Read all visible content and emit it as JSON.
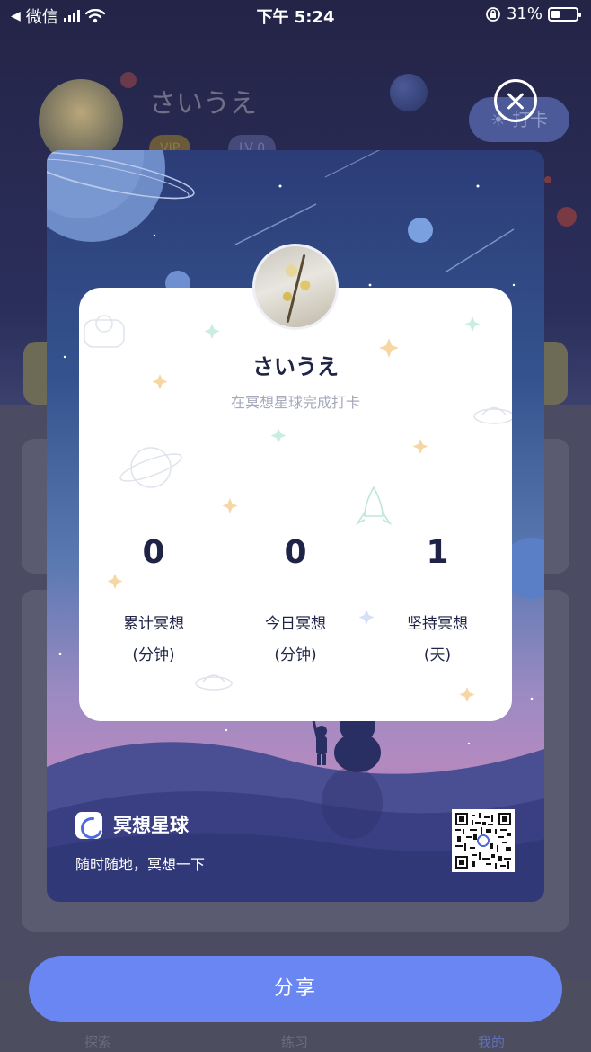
{
  "status_bar": {
    "back_app": "微信",
    "time": "下午 5:24",
    "battery": "31%"
  },
  "background_page": {
    "user_name": "さいうえ",
    "vip_badge": "VIP",
    "level_badge": "LV 0",
    "checkin_button": "打卡",
    "tabs": [
      {
        "label": "探索"
      },
      {
        "label": "练习"
      },
      {
        "label": "我的"
      }
    ]
  },
  "poster": {
    "user_name": "さいうえ",
    "subtitle": "在冥想星球完成打卡",
    "stats": [
      {
        "value": "0",
        "label": "累计冥想",
        "unit": "(分钟)"
      },
      {
        "value": "0",
        "label": "今日冥想",
        "unit": "(分钟)"
      },
      {
        "value": "1",
        "label": "坚持冥想",
        "unit": "(天)"
      }
    ],
    "brand_name": "冥想星球",
    "brand_slogan": "随时随地，冥想一下"
  },
  "share_button": "分享",
  "colors": {
    "accent": "#6a86f2",
    "card_text": "#1f2447",
    "subtitle_text": "#a5a9bb"
  },
  "icons": [
    "wifi-icon",
    "signal-icon",
    "battery-icon",
    "lock-rotation-icon",
    "close-icon",
    "sun-icon",
    "app-logo-icon",
    "qr-code"
  ]
}
